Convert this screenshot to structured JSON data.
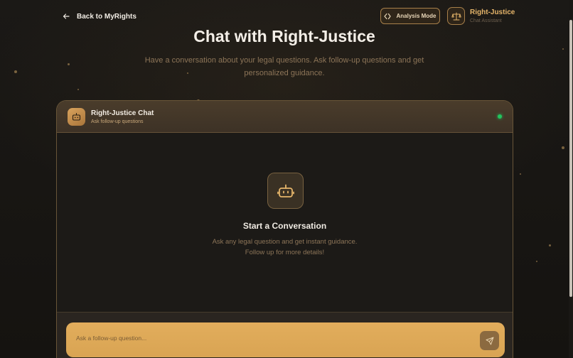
{
  "header": {
    "back_label": "Back to MyRights",
    "analysis_mode_label": "Analysis Mode",
    "brand_name": "Right-Justice",
    "brand_subtitle": "Chat Assistant"
  },
  "hero": {
    "title": "Chat with Right-Justice",
    "subtitle": "Have a conversation about your legal questions. Ask follow-up questions and get personalized guidance."
  },
  "chat": {
    "title": "Right-Justice Chat",
    "subtitle": "Ask follow-up questions",
    "status_color": "#22c55e",
    "empty_state": {
      "title": "Start a Conversation",
      "line1": "Ask any legal question and get instant guidance.",
      "line2": "Follow up for more details!"
    },
    "input_placeholder": "Ask a follow-up question...",
    "input_value": ""
  },
  "colors": {
    "accent": "#e2ad5c",
    "brand_text": "#e5b56a",
    "background": "#141210"
  },
  "icons": {
    "back": "arrow-left-icon",
    "analysis": "code-icon",
    "brand": "scale-icon",
    "chat_avatar": "bot-icon",
    "send": "send-icon"
  }
}
